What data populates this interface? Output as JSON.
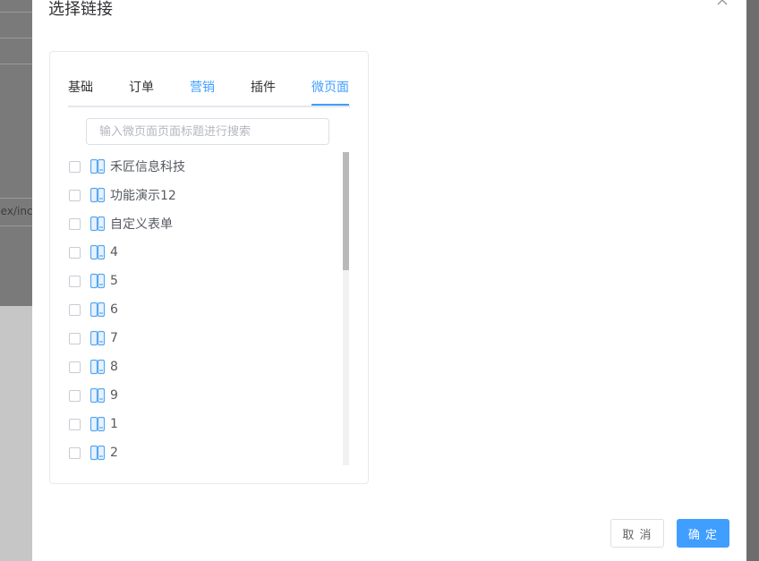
{
  "background": {
    "snippet": "ilex/inc"
  },
  "modal": {
    "title": "选择链接",
    "close_icon": "close-icon"
  },
  "tabs": [
    {
      "label": "基础",
      "color": "#303133",
      "active": false
    },
    {
      "label": "订单",
      "color": "#303133",
      "active": false
    },
    {
      "label": "营销",
      "color": "#409eff",
      "active": false
    },
    {
      "label": "插件",
      "color": "#303133",
      "active": false
    },
    {
      "label": "微页面",
      "color": "#409eff",
      "active": true
    }
  ],
  "search": {
    "placeholder": "输入微页面页面标题进行搜索",
    "value": ""
  },
  "list": {
    "item_icon": "page-icon",
    "items": [
      {
        "label": "禾匠信息科技",
        "checked": false
      },
      {
        "label": "功能演示12",
        "checked": false
      },
      {
        "label": "自定义表单",
        "checked": false
      },
      {
        "label": "4",
        "checked": false
      },
      {
        "label": "5",
        "checked": false
      },
      {
        "label": "6",
        "checked": false
      },
      {
        "label": "7",
        "checked": false
      },
      {
        "label": "8",
        "checked": false
      },
      {
        "label": "9",
        "checked": false
      },
      {
        "label": "1",
        "checked": false
      },
      {
        "label": "2",
        "checked": false
      }
    ]
  },
  "footer": {
    "cancel_label": "取 消",
    "confirm_label": "确 定"
  },
  "colors": {
    "accent": "#409eff",
    "overlay": "#6d6d6d"
  }
}
